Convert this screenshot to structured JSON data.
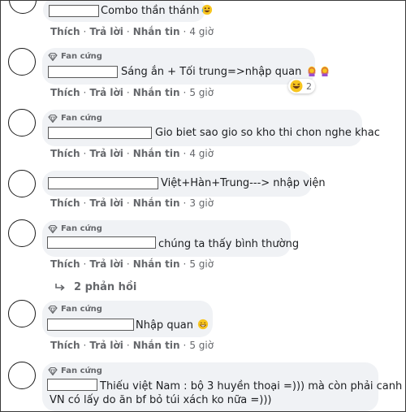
{
  "actions": {
    "like": "Thích",
    "reply": "Trả lời",
    "message": "Nhắn tin"
  },
  "badge_label": "Fan cứng",
  "comments": [
    {
      "text": "Combo thần thánh",
      "time": "4 giờ"
    },
    {
      "text": "Sáng ắn + Tối trung=>nhập quan",
      "time": "5 giờ",
      "reaction_count": "2"
    },
    {
      "text": "Gio biet sao gio so kho thi chon nghe khac",
      "time": "4 giờ"
    },
    {
      "text": "Việt+Hàn+Trung---> nhập viện",
      "time": "3 giờ"
    },
    {
      "text": "chúng ta thấy bình thường",
      "time": "5 giờ",
      "replies": "2 phản hồi"
    },
    {
      "text": "Nhập quan",
      "time": "5 giờ"
    },
    {
      "text_line1": "Thiếu việt Nam : bộ 3 huyền thoại =))) mà còn phải canh",
      "text_line2": "VN có lấy do ăn bf bỏ túi xách ko nữa =)))"
    }
  ],
  "colors": {
    "bubble": "#f0f2f5",
    "meta_text": "#65676b",
    "link": "#1877f2"
  }
}
